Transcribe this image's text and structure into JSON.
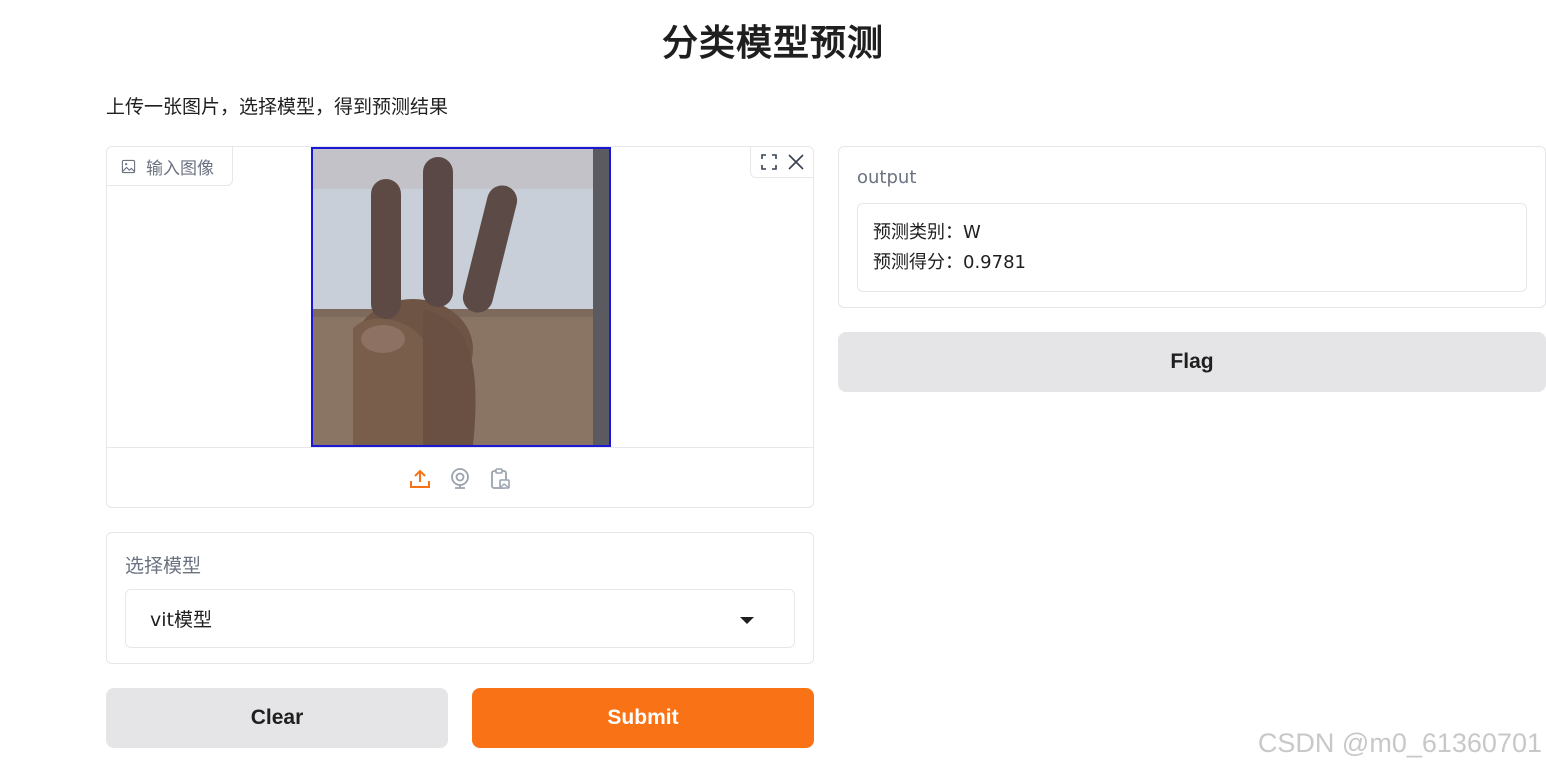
{
  "header": {
    "title": "分类模型预测",
    "description": "上传一张图片，选择模型，得到预测结果"
  },
  "image_input": {
    "label": "输入图像",
    "tools": [
      "fullscreen-icon",
      "close-icon"
    ],
    "sources": [
      "upload-icon",
      "webcam-icon",
      "clipboard-icon"
    ]
  },
  "model_select": {
    "label": "选择模型",
    "selected": "vit模型"
  },
  "buttons": {
    "clear": "Clear",
    "submit": "Submit",
    "flag": "Flag"
  },
  "output": {
    "label": "output",
    "lines": [
      "预测类别：W",
      "预测得分：0.9781"
    ]
  },
  "watermark": "CSDN @m0_61360701",
  "colors": {
    "accent": "#f97316",
    "image_border": "#1a17d6",
    "secondary_button": "#e5e5e7"
  }
}
